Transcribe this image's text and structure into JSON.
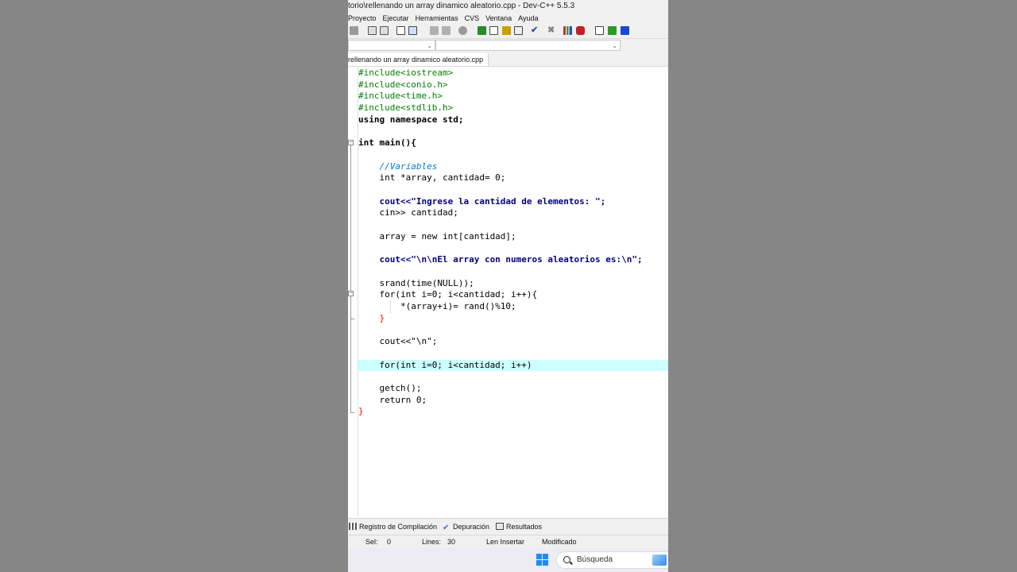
{
  "window": {
    "title": "torio\\rellenando un array dinamico aleatorio.cpp - Dev-C++ 5.5.3"
  },
  "menu": [
    "Proyecto",
    "Ejecutar",
    "Herramientas",
    "CVS",
    "Ventana",
    "Ayuda"
  ],
  "toolbar": {
    "icons": [
      "undo-icon",
      "find-icon",
      "replace-icon",
      "new-project-icon",
      "open-project-icon",
      "back-icon",
      "forward-icon",
      "stop-icon",
      "compile-icon",
      "run-icon",
      "compile-run-icon",
      "rebuild-icon",
      "check-syntax-icon",
      "clean-icon",
      "chart-icon",
      "profile-icon",
      "goto-icon",
      "debug-icon",
      "bookmark-icon"
    ]
  },
  "tab": {
    "label": "rellenando un array dinamico aleatorio.cpp"
  },
  "code": {
    "lines": [
      "#include<iostream>",
      "#include<conio.h>",
      "#include<time.h>",
      "#include<stdlib.h>",
      "using namespace std;",
      "",
      "int main(){",
      "",
      "    //Variables",
      "    int *array, cantidad= 0;",
      "",
      "    cout<<\"Ingrese la cantidad de elementos: \";",
      "    cin>> cantidad;",
      "",
      "    array = new int[cantidad];",
      "",
      "    cout<<\"\\n\\nEl array con numeros aleatorios es:\\n\";",
      "",
      "    srand(time(NULL));",
      "    for(int i=0; i<cantidad; i++){",
      "        *(array+i)= rand()%10;",
      "    }",
      "",
      "    cout<<\"\\n\";",
      "",
      "    for(int i=0; i<cantidad; i++)",
      "",
      "    getch();",
      "    return 0;",
      "}"
    ],
    "current_line": 26
  },
  "bottom_tabs": {
    "compile_log": "Registro de Compilación",
    "debug": "Depuración",
    "results": "Resultados"
  },
  "status": {
    "sel_label": "Sel:",
    "sel_value": "0",
    "lines_label": "Lines:",
    "lines_value": "30",
    "len_label": "Len Insertar",
    "modified": "Modificado"
  },
  "taskbar": {
    "search_placeholder": "Búsqueda"
  }
}
